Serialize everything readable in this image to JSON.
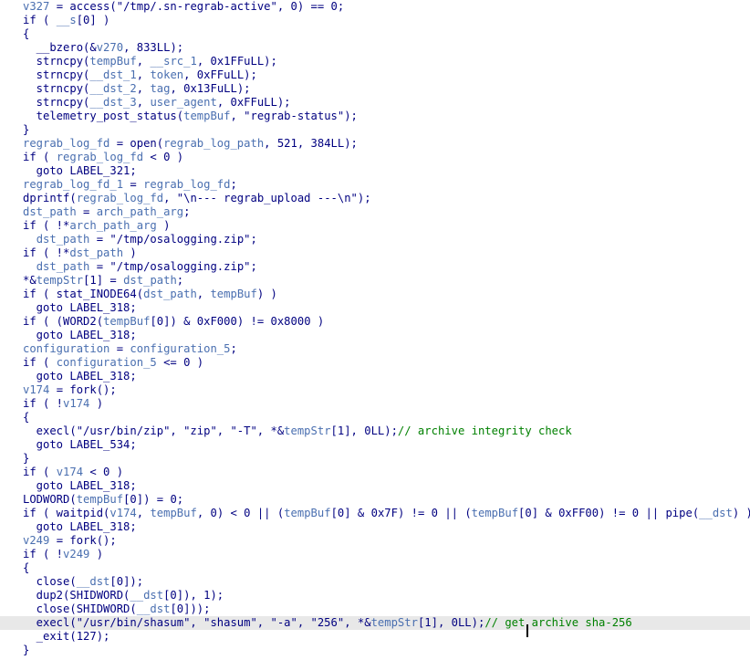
{
  "caret_line": 45,
  "lines": [
    [
      [
        "v327",
        "var"
      ],
      [
        " = access(\"/tmp/.sn-regrab-active\", 0) == 0;",
        "code"
      ]
    ],
    [
      [
        "if ( ",
        "code"
      ],
      [
        "__s",
        "var"
      ],
      [
        "[0] )",
        "code"
      ]
    ],
    [
      [
        "{",
        "code"
      ]
    ],
    [
      [
        "  __bzero(&",
        "code"
      ],
      [
        "v270",
        "var"
      ],
      [
        ", 833LL);",
        "code"
      ]
    ],
    [
      [
        "  strncpy(",
        "code"
      ],
      [
        "tempBuf",
        "var"
      ],
      [
        ", ",
        "code"
      ],
      [
        "__src_1",
        "var"
      ],
      [
        ", 0x1FFuLL);",
        "code"
      ]
    ],
    [
      [
        "  strncpy(",
        "code"
      ],
      [
        "__dst_1",
        "var"
      ],
      [
        ", ",
        "code"
      ],
      [
        "token",
        "var"
      ],
      [
        ", 0xFFuLL);",
        "code"
      ]
    ],
    [
      [
        "  strncpy(",
        "code"
      ],
      [
        "__dst_2",
        "var"
      ],
      [
        ", ",
        "code"
      ],
      [
        "tag",
        "var"
      ],
      [
        ", 0x13FuLL);",
        "code"
      ]
    ],
    [
      [
        "  strncpy(",
        "code"
      ],
      [
        "__dst_3",
        "var"
      ],
      [
        ", ",
        "code"
      ],
      [
        "user_agent",
        "var"
      ],
      [
        ", 0xFFuLL);",
        "code"
      ]
    ],
    [
      [
        "  telemetry_post_status(",
        "code"
      ],
      [
        "tempBuf",
        "var"
      ],
      [
        ", \"regrab-status\");",
        "code"
      ]
    ],
    [
      [
        "}",
        "code"
      ]
    ],
    [
      [
        "regrab_log_fd",
        "var"
      ],
      [
        " = open(",
        "code"
      ],
      [
        "regrab_log_path",
        "var"
      ],
      [
        ", 521, 384LL);",
        "code"
      ]
    ],
    [
      [
        "if ( ",
        "code"
      ],
      [
        "regrab_log_fd",
        "var"
      ],
      [
        " < 0 )",
        "code"
      ]
    ],
    [
      [
        "  goto LABEL_321;",
        "code"
      ]
    ],
    [
      [
        "regrab_log_fd_1",
        "var"
      ],
      [
        " = ",
        "code"
      ],
      [
        "regrab_log_fd",
        "var"
      ],
      [
        ";",
        "code"
      ]
    ],
    [
      [
        "dprintf(",
        "code"
      ],
      [
        "regrab_log_fd",
        "var"
      ],
      [
        ", \"\\n--- regrab_upload ---\\n\");",
        "code"
      ]
    ],
    [
      [
        "dst_path",
        "var"
      ],
      [
        " = ",
        "code"
      ],
      [
        "arch_path_arg",
        "var"
      ],
      [
        ";",
        "code"
      ]
    ],
    [
      [
        "if ( !*",
        "code"
      ],
      [
        "arch_path_arg",
        "var"
      ],
      [
        " )",
        "code"
      ]
    ],
    [
      [
        "  ",
        "code"
      ],
      [
        "dst_path",
        "var"
      ],
      [
        " = \"/tmp/osalogging.zip\";",
        "code"
      ]
    ],
    [
      [
        "if ( !*",
        "code"
      ],
      [
        "dst_path",
        "var"
      ],
      [
        " )",
        "code"
      ]
    ],
    [
      [
        "  ",
        "code"
      ],
      [
        "dst_path",
        "var"
      ],
      [
        " = \"/tmp/osalogging.zip\";",
        "code"
      ]
    ],
    [
      [
        "*&",
        "code"
      ],
      [
        "tempStr",
        "var"
      ],
      [
        "[1] = ",
        "code"
      ],
      [
        "dst_path",
        "var"
      ],
      [
        ";",
        "code"
      ]
    ],
    [
      [
        "if ( stat_INODE64(",
        "code"
      ],
      [
        "dst_path",
        "var"
      ],
      [
        ", ",
        "code"
      ],
      [
        "tempBuf",
        "var"
      ],
      [
        ") )",
        "code"
      ]
    ],
    [
      [
        "  goto LABEL_318;",
        "code"
      ]
    ],
    [
      [
        "if ( (WORD2(",
        "code"
      ],
      [
        "tempBuf",
        "var"
      ],
      [
        "[0]) & 0xF000) != 0x8000 )",
        "code"
      ]
    ],
    [
      [
        "  goto LABEL_318;",
        "code"
      ]
    ],
    [
      [
        "configuration",
        "var"
      ],
      [
        " = ",
        "code"
      ],
      [
        "configuration_5",
        "var"
      ],
      [
        ";",
        "code"
      ]
    ],
    [
      [
        "if ( ",
        "code"
      ],
      [
        "configuration_5",
        "var"
      ],
      [
        " <= 0 )",
        "code"
      ]
    ],
    [
      [
        "  goto LABEL_318;",
        "code"
      ]
    ],
    [
      [
        "v174",
        "var"
      ],
      [
        " = fork();",
        "code"
      ]
    ],
    [
      [
        "if ( !",
        "code"
      ],
      [
        "v174",
        "var"
      ],
      [
        " )",
        "code"
      ]
    ],
    [
      [
        "{",
        "code"
      ]
    ],
    [
      [
        "  execl(\"/usr/bin/zip\", \"zip\", \"-T\", *&",
        "code"
      ],
      [
        "tempStr",
        "var"
      ],
      [
        "[1], 0LL);",
        "code"
      ],
      [
        "// archive integrity check",
        "cmt"
      ]
    ],
    [
      [
        "  goto LABEL_534;",
        "code"
      ]
    ],
    [
      [
        "}",
        "code"
      ]
    ],
    [
      [
        "if ( ",
        "code"
      ],
      [
        "v174",
        "var"
      ],
      [
        " < 0 )",
        "code"
      ]
    ],
    [
      [
        "  goto LABEL_318;",
        "code"
      ]
    ],
    [
      [
        "LODWORD(",
        "code"
      ],
      [
        "tempBuf",
        "var"
      ],
      [
        "[0]) = 0;",
        "code"
      ]
    ],
    [
      [
        "if ( waitpid(",
        "code"
      ],
      [
        "v174",
        "var"
      ],
      [
        ", ",
        "code"
      ],
      [
        "tempBuf",
        "var"
      ],
      [
        ", 0) < 0 || (",
        "code"
      ],
      [
        "tempBuf",
        "var"
      ],
      [
        "[0] & 0x7F) != 0 || (",
        "code"
      ],
      [
        "tempBuf",
        "var"
      ],
      [
        "[0] & 0xFF00) != 0 || pipe(",
        "code"
      ],
      [
        "__dst",
        "var"
      ],
      [
        ") )",
        "code"
      ]
    ],
    [
      [
        "  goto LABEL_318;",
        "code"
      ]
    ],
    [
      [
        "v249",
        "var"
      ],
      [
        " = fork();",
        "code"
      ]
    ],
    [
      [
        "if ( !",
        "code"
      ],
      [
        "v249",
        "var"
      ],
      [
        " )",
        "code"
      ]
    ],
    [
      [
        "{",
        "code"
      ]
    ],
    [
      [
        "  close(",
        "code"
      ],
      [
        "__dst",
        "var"
      ],
      [
        "[0]);",
        "code"
      ]
    ],
    [
      [
        "  dup2(SHIDWORD(",
        "code"
      ],
      [
        "__dst",
        "var"
      ],
      [
        "[0]), 1);",
        "code"
      ]
    ],
    [
      [
        "  close(SHIDWORD(",
        "code"
      ],
      [
        "__dst",
        "var"
      ],
      [
        "[0]));",
        "code"
      ]
    ],
    [
      [
        "  execl(\"/usr/bin/shasum\", \"shasum\", \"-a\", \"256\", *&",
        "code"
      ],
      [
        "tempStr",
        "var"
      ],
      [
        "[1], 0LL);",
        "code"
      ],
      [
        "// get archive sha-256",
        "cmt"
      ]
    ],
    [
      [
        "  _exit(127);",
        "code"
      ]
    ],
    [
      [
        "}",
        "code"
      ]
    ]
  ]
}
